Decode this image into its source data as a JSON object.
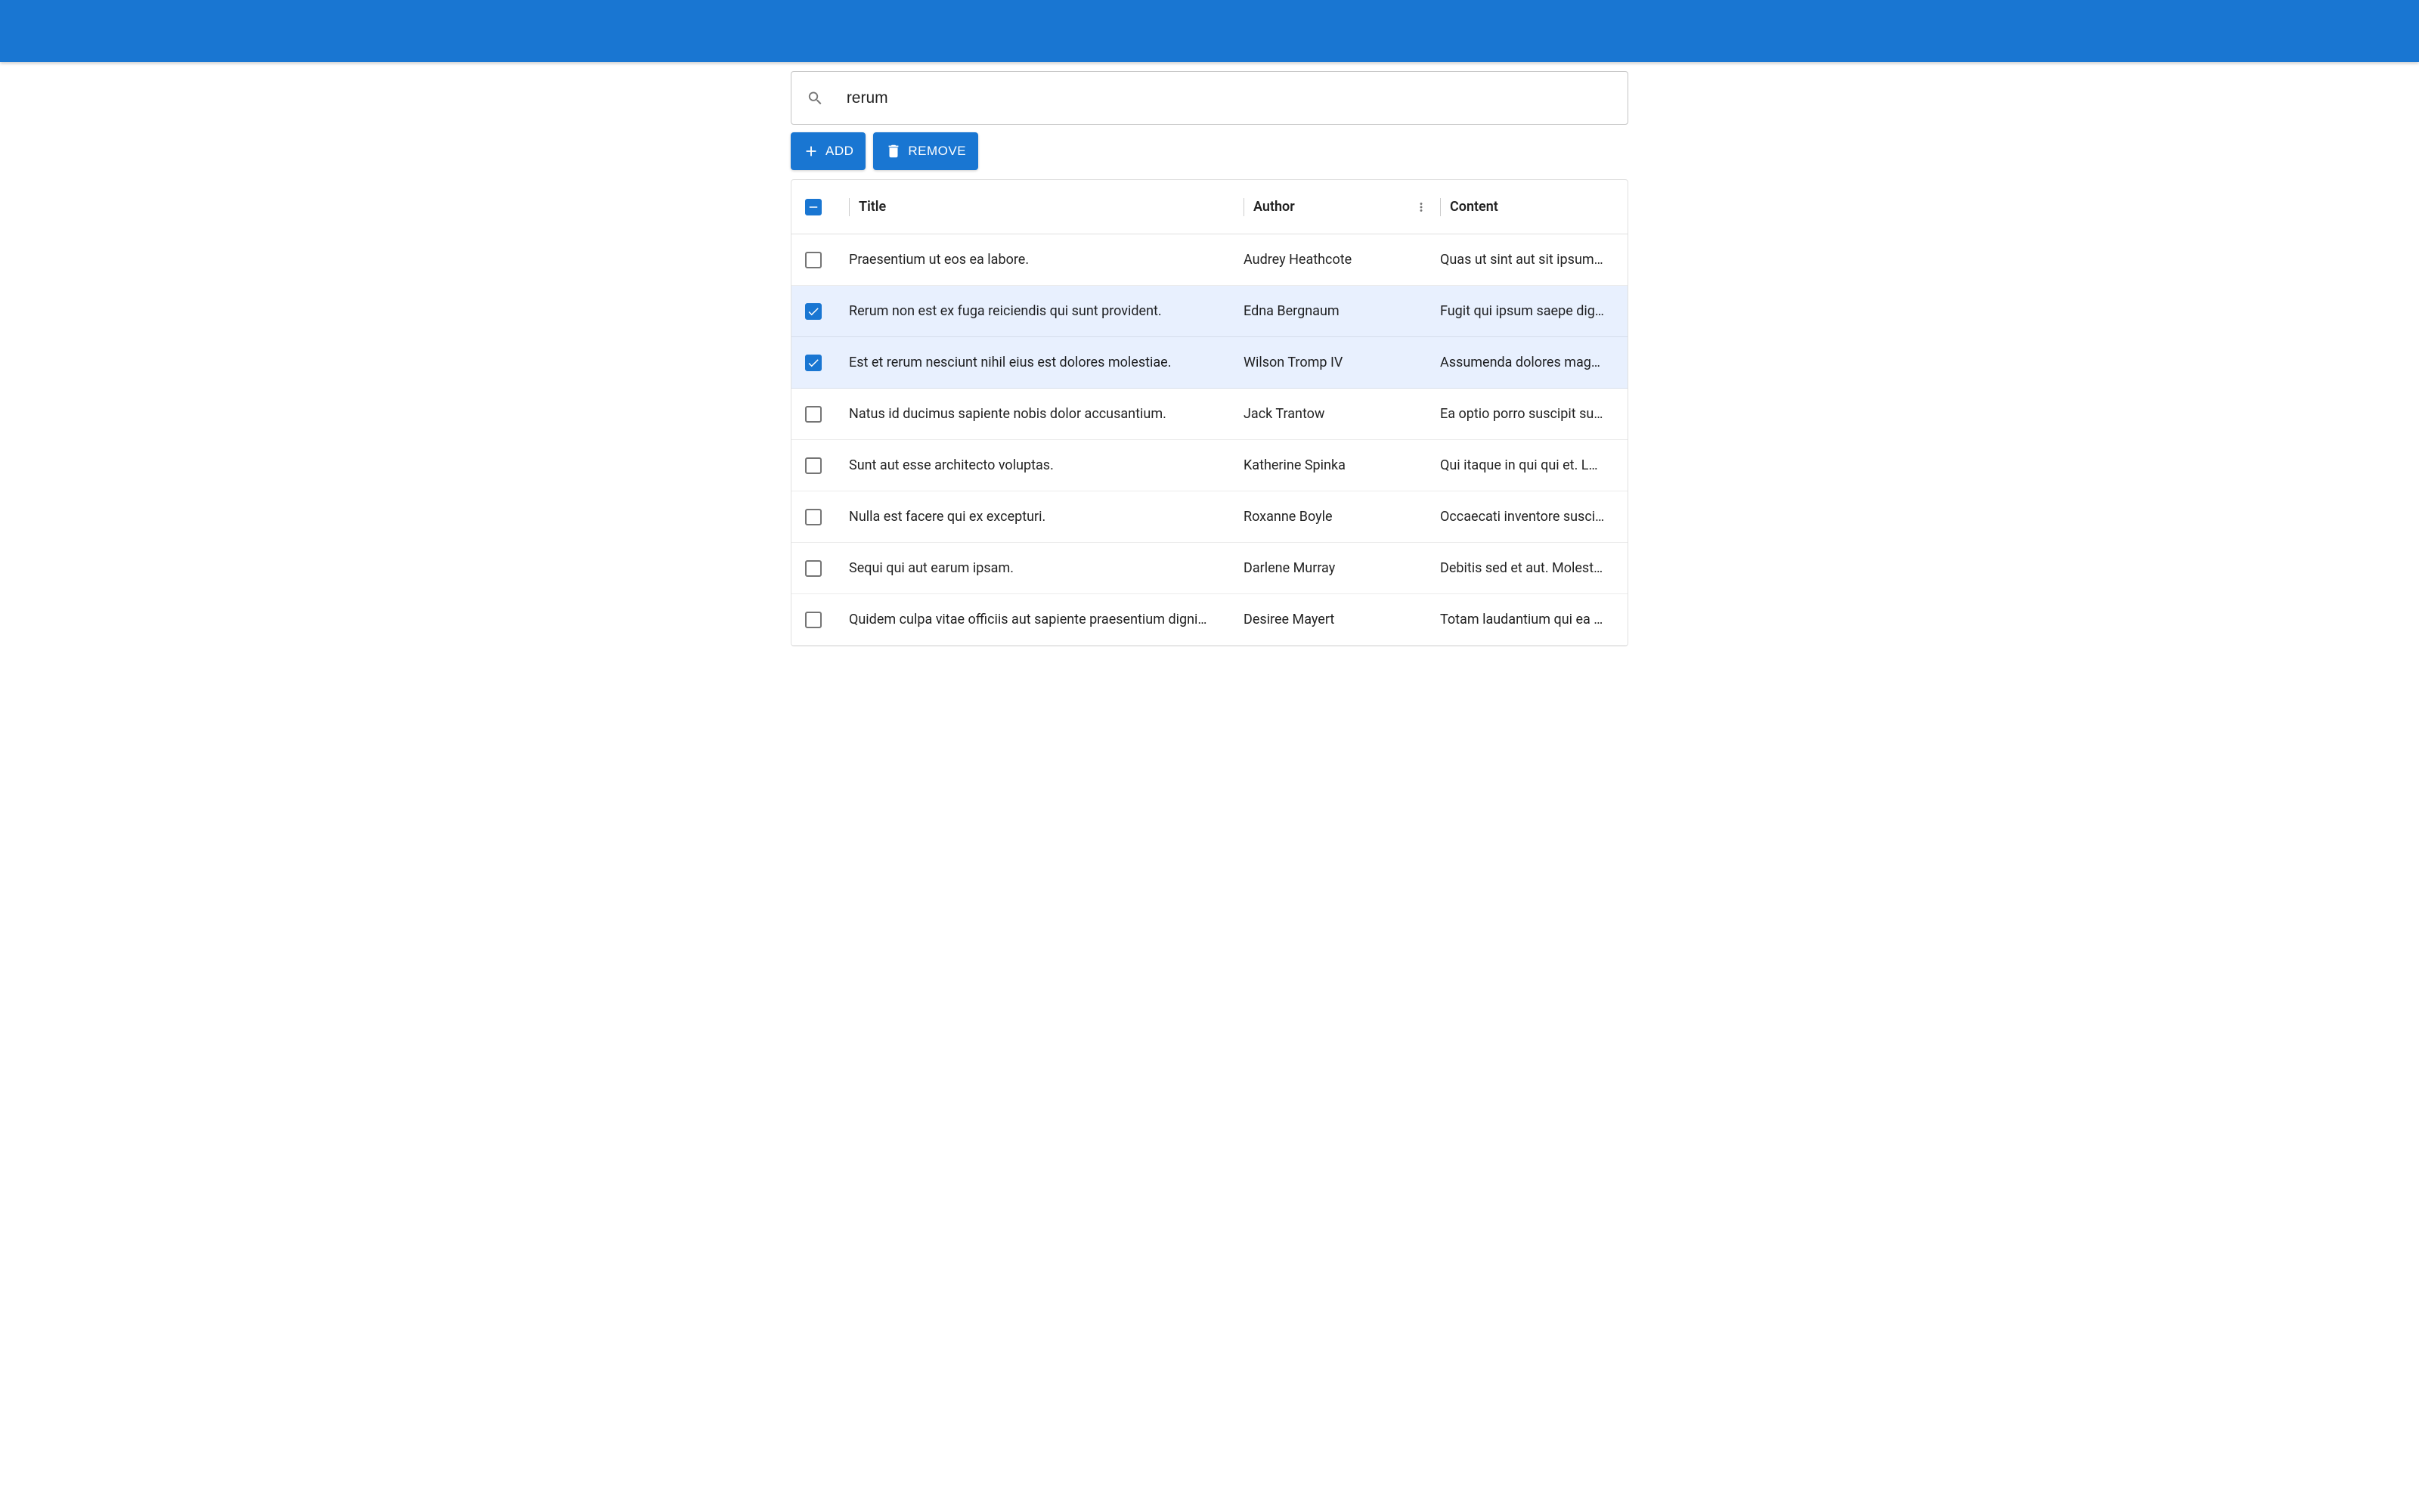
{
  "search": {
    "value": "rerum"
  },
  "toolbar": {
    "add_label": "ADD",
    "remove_label": "REMOVE"
  },
  "grid": {
    "header_checkbox_state": "indeterminate",
    "columns": {
      "title": "Title",
      "author": "Author",
      "content": "Content"
    },
    "rows": [
      {
        "selected": false,
        "title": "Praesentium ut eos ea labore.",
        "author": "Audrey Heathcote",
        "content": "Quas ut sint aut sit ipsum …"
      },
      {
        "selected": true,
        "title": "Rerum non est ex fuga reiciendis qui sunt provident.",
        "author": "Edna Bergnaum",
        "content": "Fugit qui ipsum saepe dig…"
      },
      {
        "selected": true,
        "title": "Est et rerum nesciunt nihil eius est dolores molestiae.",
        "author": "Wilson Tromp IV",
        "content": "Assumenda dolores magn…"
      },
      {
        "selected": false,
        "title": "Natus id ducimus sapiente nobis dolor accusantium.",
        "author": "Jack Trantow",
        "content": "Ea optio porro suscipit sun…"
      },
      {
        "selected": false,
        "title": "Sunt aut esse architecto voluptas.",
        "author": "Katherine Spinka",
        "content": "Qui itaque in qui qui et. La…"
      },
      {
        "selected": false,
        "title": "Nulla est facere qui ex excepturi.",
        "author": "Roxanne Boyle",
        "content": "Occaecati inventore susci…"
      },
      {
        "selected": false,
        "title": "Sequi qui aut earum ipsam.",
        "author": "Darlene Murray",
        "content": "Debitis sed et aut. Molesti…"
      },
      {
        "selected": false,
        "title": "Quidem culpa vitae officiis aut sapiente praesentium digni…",
        "author": "Desiree Mayert",
        "content": "Totam laudantium qui ea u…"
      }
    ]
  },
  "colors": {
    "primary": "#1976d2",
    "selected_row": "#e8f0fe"
  }
}
